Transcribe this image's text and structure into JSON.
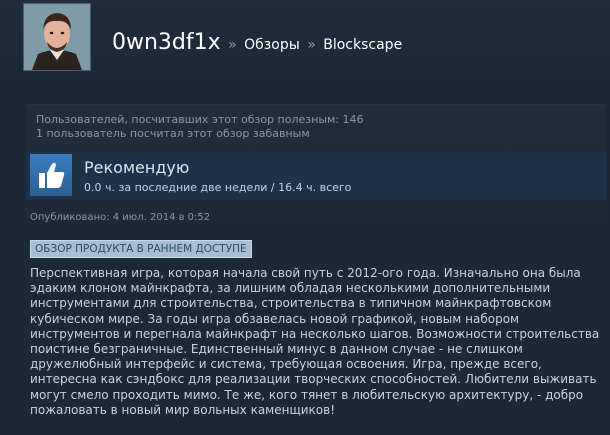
{
  "header": {
    "username": "0wn3df1x",
    "separator": "»",
    "breadcrumb_reviews": "Обзоры",
    "breadcrumb_game": "Blockscape"
  },
  "helpful": {
    "line1": "Пользователей, посчитавших этот обзор полезным: 146",
    "line2": "1 пользователь посчитал этот обзор забавным"
  },
  "review": {
    "verdict": "Рекомендую",
    "hours": "0.0 ч. за последние две недели / 16.4 ч. всего",
    "posted": "Опубликовано: 4 июл. 2014 в 0:52",
    "early_access_badge": "ОБЗОР ПРОДУКТА В РАННЕМ ДОСТУПЕ",
    "text": "Перспективная игра, которая начала свой путь с 2012-ого года. Изначально она была эдаким клоном майнкрафта, за лишним обладая несколькими дополнительными инструментами для строительства, строительства в типичном майнкрафтовском кубическом мире. За годы игра обзавелась новой графикой, новым набором инструментов и перегнала майнкрафт на несколько шагов. Возможности строительства поистине безграничные. Единственный минус в данном случае - не слишком дружелюбный интерфейс и система, требующая освоения. Игра, прежде всего, интересна как сэндбокс для реализации творческих способностей. Любители выживать могут смело проходить мимо. Те же, кого тянет в любительскую архитектуру, - добро пожаловать в новый мир вольных каменщиков!"
  },
  "icons": {
    "avatar": "user-portrait-avatar",
    "thumb": "thumbs-up-icon"
  },
  "colors": {
    "background": "#1b2838",
    "thumb_blue": "#3a7dc4",
    "badge_bg": "#a9bed3"
  }
}
